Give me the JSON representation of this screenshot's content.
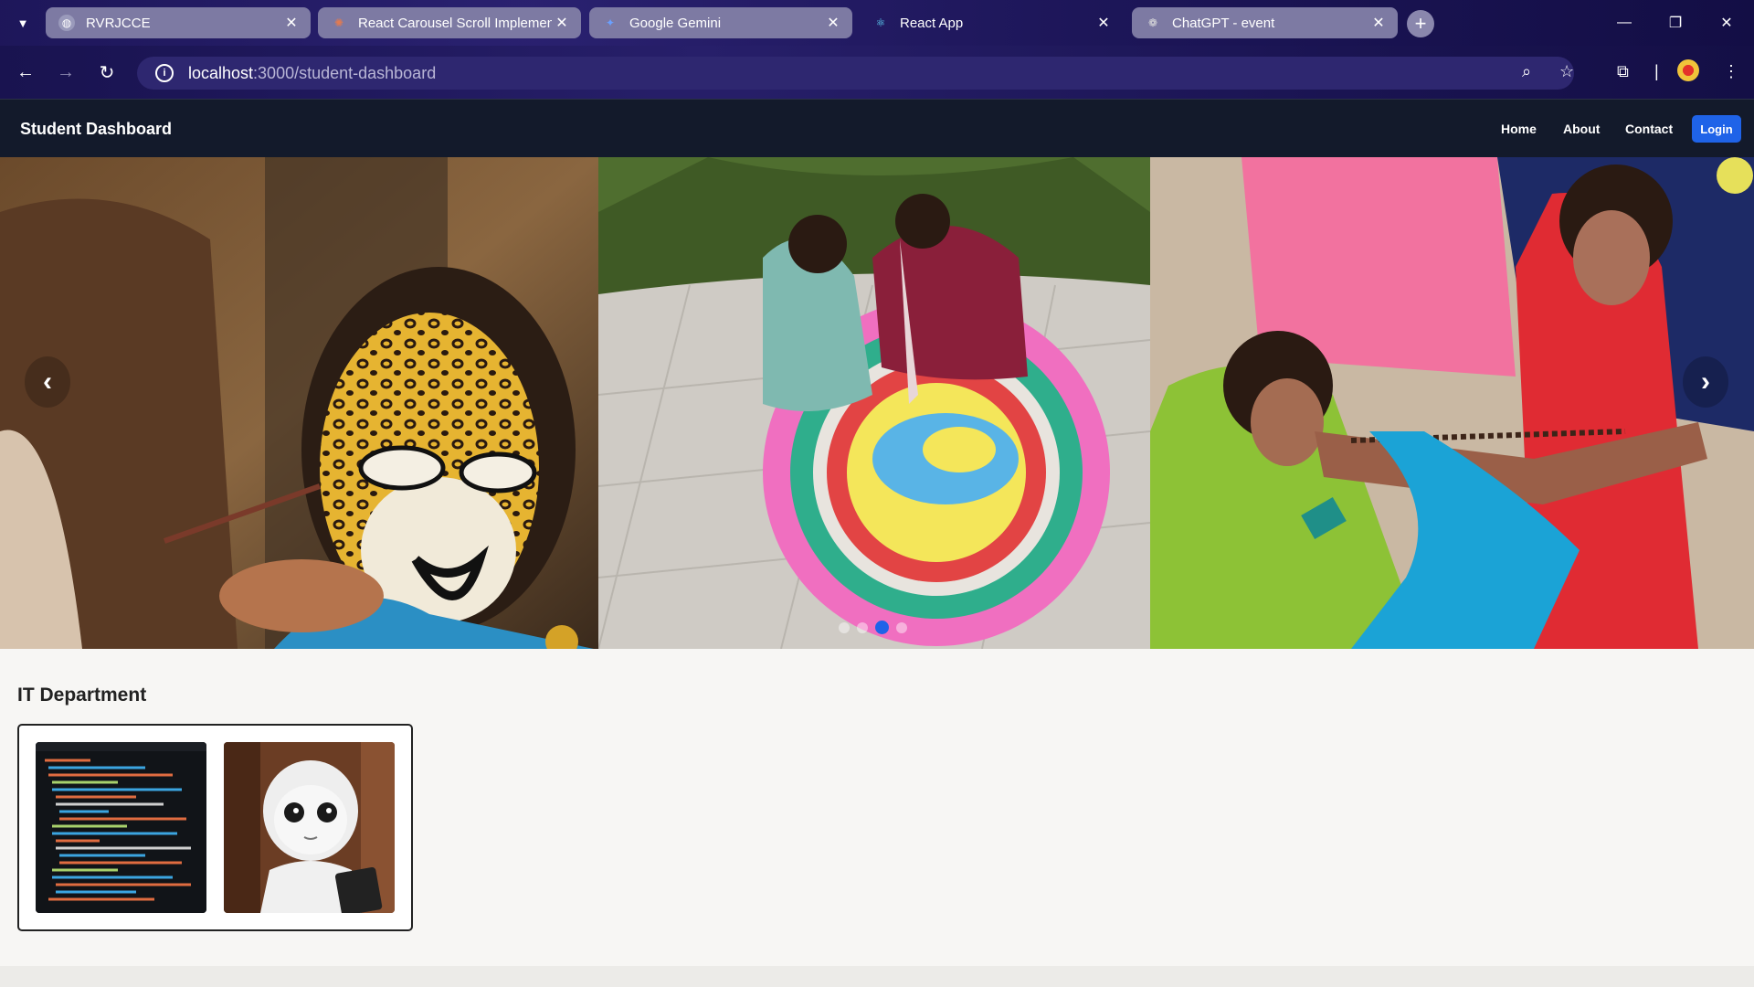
{
  "browser": {
    "tabs": [
      {
        "title": "RVRJCCE",
        "favicon": "globe-icon",
        "active": false
      },
      {
        "title": "React Carousel Scroll Implemen",
        "favicon": "claude-icon",
        "active": false
      },
      {
        "title": "Google Gemini",
        "favicon": "gemini-icon",
        "active": false
      },
      {
        "title": "React App",
        "favicon": "react-icon",
        "active": true
      },
      {
        "title": "ChatGPT - event",
        "favicon": "chatgpt-icon",
        "active": false
      }
    ],
    "new_tab_symbol": "+",
    "close_symbol": "✕",
    "url_host": "localhost",
    "url_path": ":3000/student-dashboard"
  },
  "navbar": {
    "brand": "Student Dashboard",
    "links": [
      "Home",
      "About",
      "Contact"
    ],
    "login": "Login"
  },
  "carousel": {
    "prev_symbol": "‹",
    "next_symbol": "›",
    "slide_count": 4,
    "active_index": 2
  },
  "department": {
    "title": "IT Department"
  },
  "colors": {
    "accent": "#1f63e8",
    "navbar_bg": "#131a2b",
    "browser_bg": "#1d1659"
  }
}
